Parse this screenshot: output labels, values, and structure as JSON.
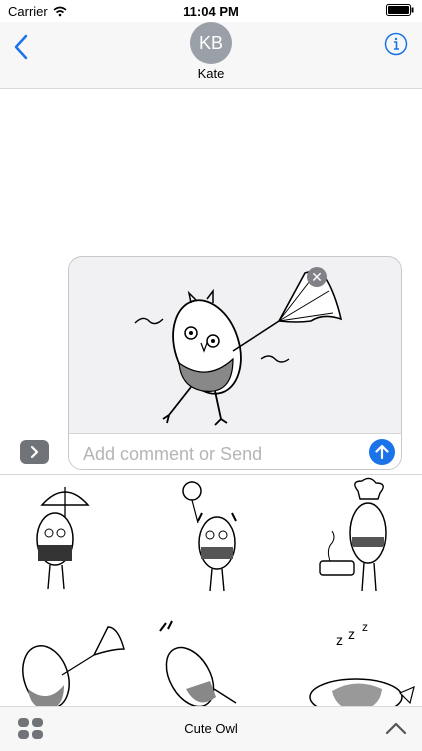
{
  "status_bar": {
    "carrier": "Carrier",
    "time": "11:04 PM"
  },
  "header": {
    "avatar_initials": "KB",
    "contact_name": "Kate"
  },
  "compose": {
    "comment_placeholder": "Add comment or Send"
  },
  "app_bar": {
    "title": "Cute Owl"
  },
  "icons": {
    "back": "chevron-left-icon",
    "info": "info-icon",
    "remove": "close-icon",
    "send": "arrow-up-icon",
    "expand": "chevron-right-icon",
    "apps": "apps-grid-icon",
    "collapse": "chevron-up-icon"
  },
  "colors": {
    "accent": "#1a73e8",
    "header_bg": "#f7f7f7",
    "card_bg": "#f1f1f3",
    "muted": "#b5b5b8"
  }
}
